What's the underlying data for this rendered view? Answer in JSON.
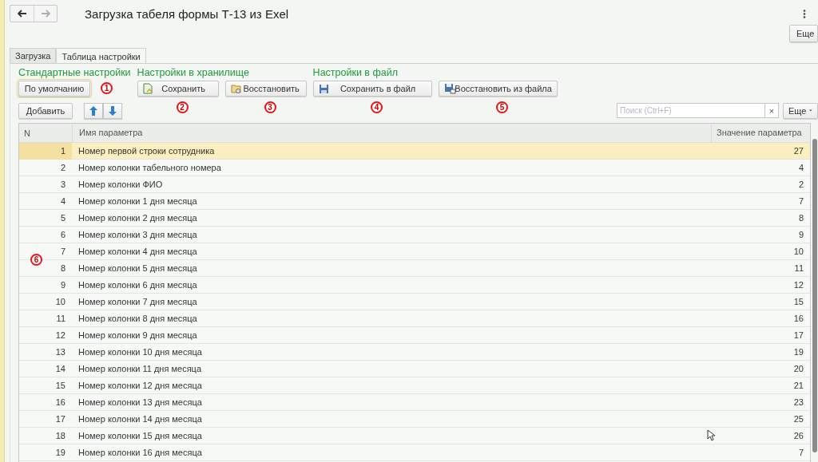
{
  "nav_buttons": [
    {
      "kind": "back",
      "disabled": false
    },
    {
      "kind": "forward",
      "disabled": true
    }
  ],
  "title": "Загрузка табеля формы Т-13 из Exel",
  "more_button": "Еще",
  "tabs": [
    {
      "label": "Загрузка",
      "selected": false
    },
    {
      "label": "Таблица настройки",
      "selected": true
    }
  ],
  "groups": [
    {
      "label": "Стандартные настройки",
      "buttons": [
        {
          "label": "По умолчанию",
          "kind": "plain",
          "marker": "1",
          "focused": true
        }
      ]
    },
    {
      "label": "Настройки в хранилище",
      "buttons": [
        {
          "label": "Сохранить",
          "kind": "save",
          "marker": "2",
          "focused": false
        },
        {
          "label": "Восстановить",
          "kind": "restore",
          "marker": "3",
          "focused": false
        }
      ]
    },
    {
      "label": "Настройки в файл",
      "buttons": [
        {
          "label": "Сохранить в файл",
          "kind": "save-file",
          "marker": "4",
          "focused": false
        },
        {
          "label": "Восстановить из файла",
          "kind": "restore-file",
          "marker": "5",
          "focused": false
        }
      ]
    }
  ],
  "toolbar": {
    "add_button": "Добавить",
    "move_buttons": [
      {
        "kind": "up"
      },
      {
        "kind": "down"
      }
    ],
    "search": {
      "placeholder": "Поиск (Ctrl+F)",
      "clear": "×"
    },
    "more_button": "Еще"
  },
  "table": {
    "columns": [
      "N",
      "Имя параметра",
      "Значение параметра"
    ],
    "marker": "6",
    "rows": [
      {
        "n": "1",
        "name": "Номер первой строки сотрудника",
        "value": "27",
        "selected": true
      },
      {
        "n": "2",
        "name": "Номер колонки табельного номера",
        "value": "4",
        "selected": false
      },
      {
        "n": "3",
        "name": "Номер колонки ФИО",
        "value": "2",
        "selected": false
      },
      {
        "n": "4",
        "name": "Номер колонки 1 дня месяца",
        "value": "7",
        "selected": false
      },
      {
        "n": "5",
        "name": "Номер колонки 2 дня месяца",
        "value": "8",
        "selected": false
      },
      {
        "n": "6",
        "name": "Номер колонки 3 дня месяца",
        "value": "9",
        "selected": false
      },
      {
        "n": "7",
        "name": "Номер колонки 4 дня месяца",
        "value": "10",
        "selected": false
      },
      {
        "n": "8",
        "name": "Номер колонки 5 дня месяца",
        "value": "11",
        "selected": false
      },
      {
        "n": "9",
        "name": "Номер колонки 6 дня месяца",
        "value": "12",
        "selected": false
      },
      {
        "n": "10",
        "name": "Номер колонки 7 дня месяца",
        "value": "15",
        "selected": false
      },
      {
        "n": "11",
        "name": "Номер колонки 8 дня месяца",
        "value": "16",
        "selected": false
      },
      {
        "n": "12",
        "name": "Номер колонки 9 дня месяца",
        "value": "17",
        "selected": false
      },
      {
        "n": "13",
        "name": "Номер колонки 10 дня месяца",
        "value": "19",
        "selected": false
      },
      {
        "n": "14",
        "name": "Номер колонки 11 дня месяца",
        "value": "20",
        "selected": false
      },
      {
        "n": "15",
        "name": "Номер колонки 12 дня месяца",
        "value": "21",
        "selected": false
      },
      {
        "n": "16",
        "name": "Номер колонки 13 дня месяца",
        "value": "23",
        "selected": false
      },
      {
        "n": "17",
        "name": "Номер колонки 14 дня месяца",
        "value": "25",
        "selected": false
      },
      {
        "n": "18",
        "name": "Номер колонки 15 дня месяца",
        "value": "26",
        "selected": false
      },
      {
        "n": "19",
        "name": "Номер колонки 16 дня месяца",
        "value": "7",
        "selected": false
      }
    ]
  }
}
